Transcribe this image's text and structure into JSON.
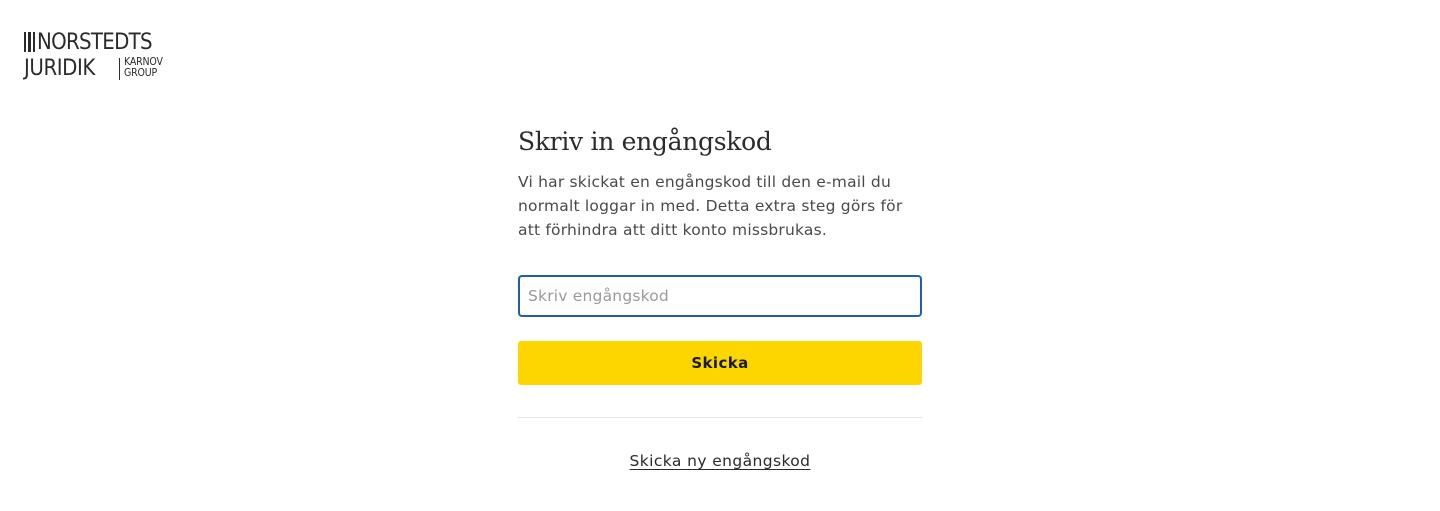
{
  "logo": {
    "line1": "NORSTEDTS",
    "line2": "JURIDIK",
    "group_line1": "KARNOV",
    "group_line2": "GROUP"
  },
  "form": {
    "title": "Skriv in engångskod",
    "description": "Vi har skickat en engångskod till den e-mail du normalt loggar in med. Detta extra steg görs för att förhindra att ditt konto missbrukas.",
    "code_input": {
      "placeholder": "Skriv engångskod",
      "value": ""
    },
    "submit_label": "Skicka",
    "resend_label": "Skicka ny engångskod"
  },
  "colors": {
    "accent": "#fdd600",
    "input_focus_border": "#1f5fa8"
  }
}
